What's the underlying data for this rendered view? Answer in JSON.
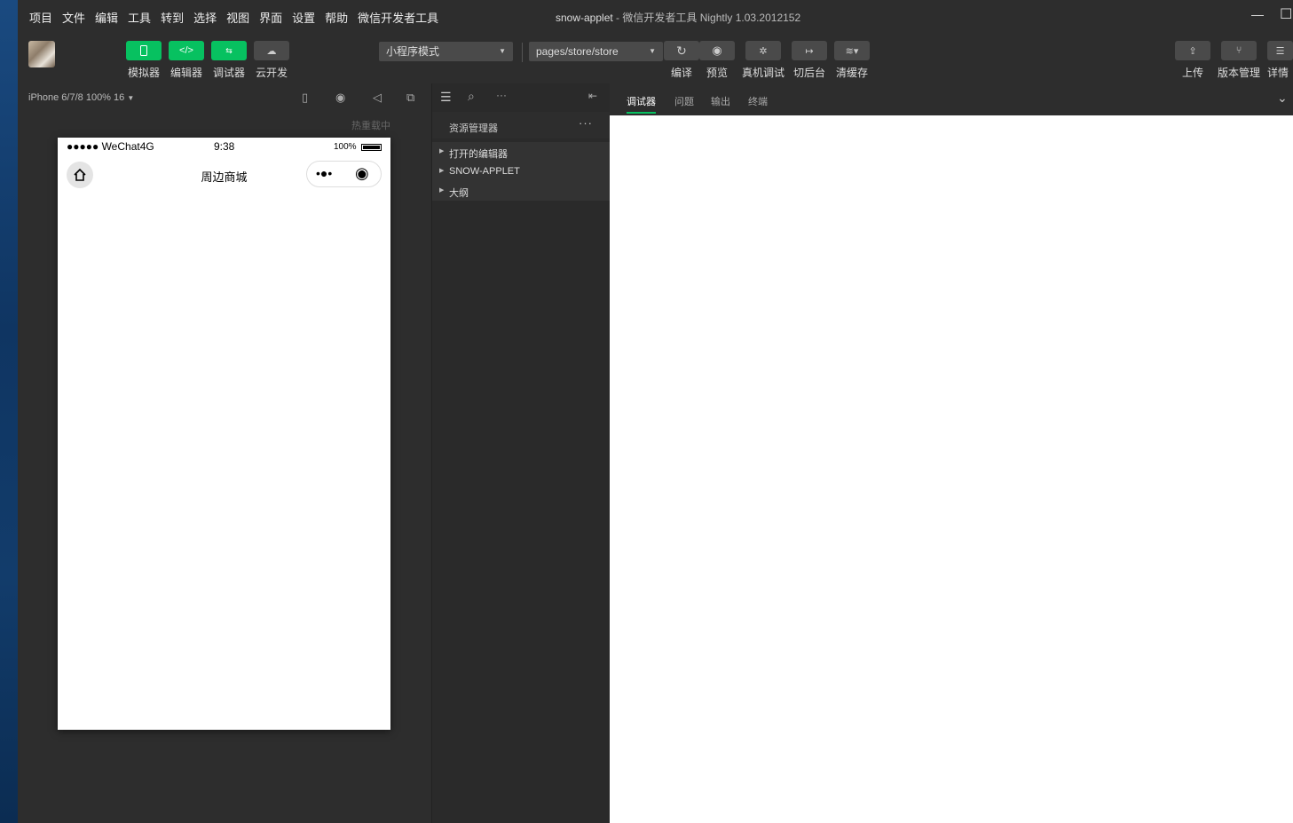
{
  "menu": [
    "项目",
    "文件",
    "编辑",
    "工具",
    "转到",
    "选择",
    "视图",
    "界面",
    "设置",
    "帮助",
    "微信开发者工具"
  ],
  "window": {
    "project": "snow-applet",
    "subtitle": " - 微信开发者工具 Nightly 1.03.2012152",
    "minimize": "—",
    "maximize": "☐"
  },
  "toolbar": {
    "simulator": "模拟器",
    "editor": "编辑器",
    "debugger": "调试器",
    "cloud": "云开发",
    "mode": "小程序模式",
    "page": "pages/store/store",
    "compile": "编译",
    "preview": "预览",
    "realdevice": "真机调试",
    "background": "切后台",
    "clearcache": "清缓存",
    "upload": "上传",
    "version": "版本管理",
    "details": "详情"
  },
  "simbar": {
    "device": "iPhone 6/7/8 100% 16",
    "hotreload": "热重载中"
  },
  "phone": {
    "carrier": "●●●●● WeChat4G",
    "time": "9:38",
    "battery": "100%",
    "title": "周边商城",
    "capsule_dots": "•●•",
    "capsule_target": "◉"
  },
  "explorer": {
    "title": "资源管理器",
    "more": "···",
    "items": [
      "打开的编辑器",
      "SNOW-APPLET",
      "大纲"
    ]
  },
  "debug": {
    "tabs": [
      "调试器",
      "问题",
      "输出",
      "终端"
    ],
    "collapse": "⌄"
  },
  "colors": {
    "accent": "#07c160",
    "panel": "#2d2d2d",
    "sidebar": "#2a2a2a"
  }
}
